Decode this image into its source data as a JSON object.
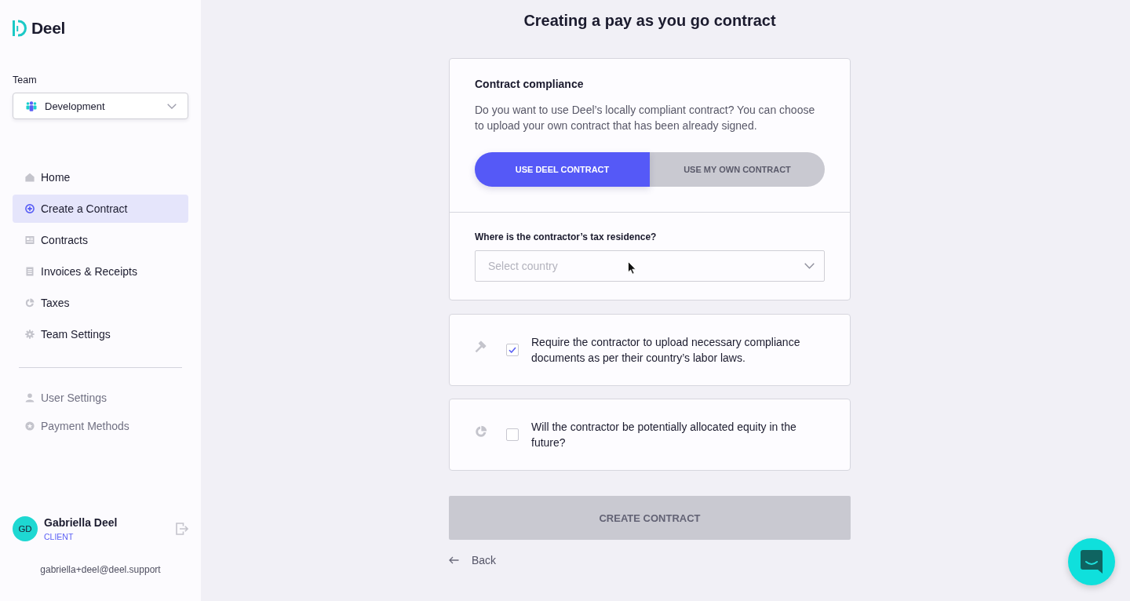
{
  "sidebar": {
    "logo": {
      "text": "Deel"
    },
    "team": {
      "label": "Team",
      "value": "Development"
    },
    "nav_items": [
      {
        "label": "Home",
        "selected": false
      },
      {
        "label": "Create a Contract",
        "selected": true
      },
      {
        "label": "Contracts",
        "selected": false
      },
      {
        "label": "Invoices & Receipts",
        "selected": false
      },
      {
        "label": "Taxes",
        "selected": false
      },
      {
        "label": "Team Settings",
        "selected": false
      }
    ],
    "account_items": [
      {
        "label": "User Settings"
      },
      {
        "label": "Payment Methods"
      }
    ],
    "user": {
      "initials": "GD",
      "name": "Gabriella Deel",
      "role": "CLIENT",
      "email": "gabriella+deel@deel.support"
    }
  },
  "page": {
    "title": "Creating a pay as you go contract"
  },
  "compliance_card": {
    "title": "Contract compliance",
    "description": "Do you want to use Deel’s locally compliant contract? You can choose to upload your own contract that has been already signed.",
    "contract_options": [
      {
        "label": "USE DEEL CONTRACT",
        "selected": true
      },
      {
        "label": "USE MY OWN CONTRACT",
        "selected": false
      }
    ],
    "tax_residence": {
      "label": "Where is the contractor’s tax residence?",
      "placeholder": "Select country"
    }
  },
  "options": [
    {
      "text": "Require the contractor to upload necessary compliance documents as per their country’s labor laws.",
      "checked": true
    },
    {
      "text": "Will the contractor be potentially allocated equity in the future?",
      "checked": false
    }
  ],
  "create_button": {
    "label": "CREATE CONTRACT",
    "disabled": true
  },
  "back_link": {
    "label": "Back"
  }
}
